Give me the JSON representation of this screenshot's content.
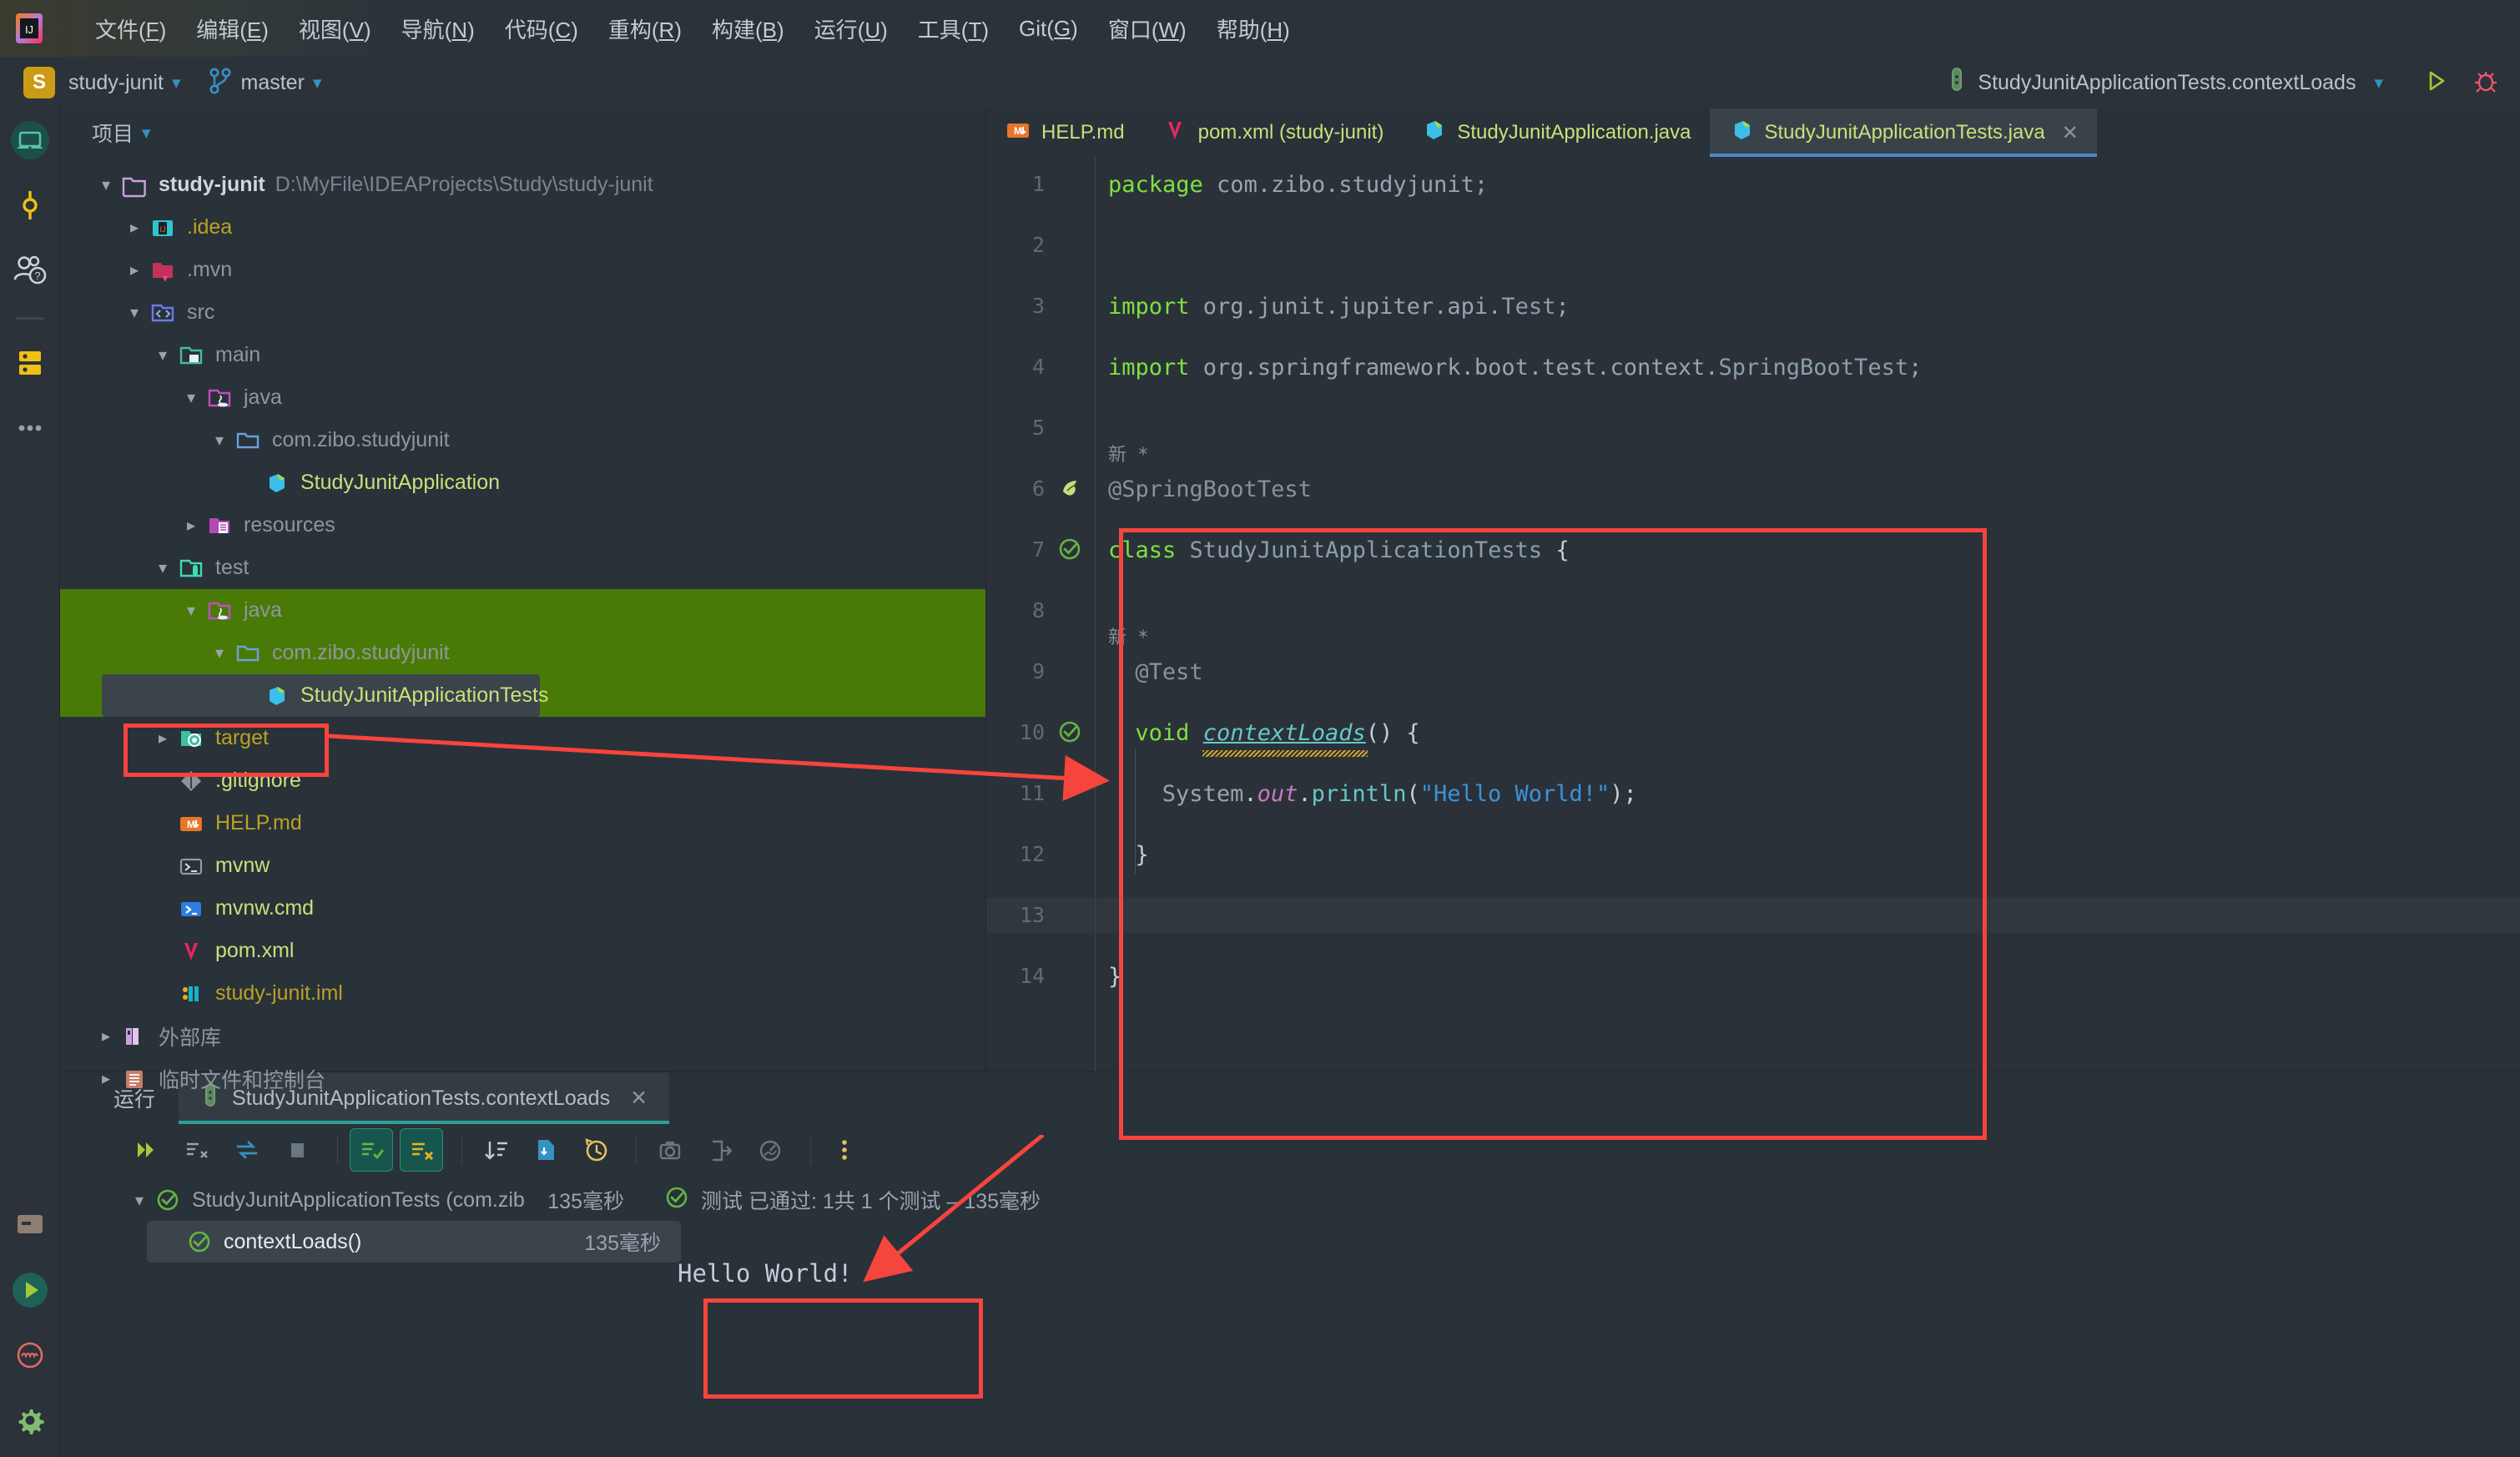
{
  "menubar": {
    "items": [
      {
        "label": "文件(F)",
        "mnemonic": "F"
      },
      {
        "label": "编辑(E)",
        "mnemonic": "E"
      },
      {
        "label": "视图(V)",
        "mnemonic": "V"
      },
      {
        "label": "导航(N)",
        "mnemonic": "N"
      },
      {
        "label": "代码(C)",
        "mnemonic": "C"
      },
      {
        "label": "重构(R)",
        "mnemonic": "R"
      },
      {
        "label": "构建(B)",
        "mnemonic": "B"
      },
      {
        "label": "运行(U)",
        "mnemonic": "U"
      },
      {
        "label": "工具(T)",
        "mnemonic": "T"
      },
      {
        "label": "Git(G)",
        "mnemonic": "G"
      },
      {
        "label": "窗口(W)",
        "mnemonic": "W"
      },
      {
        "label": "帮助(H)",
        "mnemonic": "H"
      }
    ]
  },
  "navbar": {
    "project_badge": "S",
    "project_name": "study-junit",
    "branch_name": "master",
    "run_config": "StudyJunitApplicationTests.contextLoads"
  },
  "toolstrip": {
    "items": [
      {
        "name": "project-tool-window",
        "icon": "laptop-icon",
        "active": true
      },
      {
        "name": "commit-tool-window",
        "icon": "commit-icon",
        "active": false
      },
      {
        "name": "support-tool-window",
        "icon": "people-question-icon",
        "active": false
      },
      {
        "name": "database-tool-window",
        "icon": "database-icon",
        "active": false
      },
      {
        "name": "more-tool-windows",
        "icon": "ellipsis-icon",
        "active": false
      }
    ],
    "bottom_items": [
      {
        "name": "terminal-tool-window",
        "icon": "terminal-icon"
      },
      {
        "name": "run-tool-window",
        "icon": "run-circle-icon"
      },
      {
        "name": "problems-tool-window",
        "icon": "problems-circle-icon"
      },
      {
        "name": "settings",
        "icon": "gear-icon"
      }
    ]
  },
  "project_panel": {
    "title": "项目",
    "tree": [
      {
        "label": "study-junit",
        "path": "D:\\MyFile\\IDEAProjects\\Study\\study-junit",
        "depth": 0,
        "arrow": "down",
        "icon": "folder-root-icon",
        "style": "root"
      },
      {
        "label": ".idea",
        "depth": 1,
        "arrow": "right",
        "icon": "idea-folder-icon",
        "style": "yellow"
      },
      {
        "label": ".mvn",
        "depth": 1,
        "arrow": "right",
        "icon": "mvn-folder-icon",
        "style": "dim"
      },
      {
        "label": "src",
        "depth": 1,
        "arrow": "down",
        "icon": "src-folder-icon",
        "style": "dim"
      },
      {
        "label": "main",
        "depth": 2,
        "arrow": "down",
        "icon": "main-folder-icon",
        "style": "dim"
      },
      {
        "label": "java",
        "depth": 3,
        "arrow": "down",
        "icon": "java-src-folder-icon",
        "style": "dim"
      },
      {
        "label": "com.zibo.studyjunit",
        "depth": 4,
        "arrow": "down",
        "icon": "package-folder-icon",
        "style": "dim"
      },
      {
        "label": "StudyJunitApplication",
        "depth": 5,
        "arrow": "none",
        "icon": "spring-class-icon",
        "style": "green"
      },
      {
        "label": "resources",
        "depth": 3,
        "arrow": "right",
        "icon": "resources-folder-icon",
        "style": "dim"
      },
      {
        "label": "test",
        "depth": 2,
        "arrow": "down",
        "icon": "test-folder-icon",
        "style": "dim"
      },
      {
        "label": "java",
        "depth": 3,
        "arrow": "down",
        "icon": "java-test-folder-icon",
        "style": "dim",
        "highlight": "green"
      },
      {
        "label": "com.zibo.studyjunit",
        "depth": 4,
        "arrow": "down",
        "icon": "package-folder-icon",
        "style": "dim",
        "highlight": "green"
      },
      {
        "label": "StudyJunitApplicationTests",
        "depth": 5,
        "arrow": "none",
        "icon": "spring-class-icon",
        "style": "green",
        "highlight": "green",
        "selected": true
      },
      {
        "label": "target",
        "depth": 2,
        "arrow": "right",
        "icon": "target-folder-icon",
        "style": "yellow"
      },
      {
        "label": ".gitignore",
        "depth": 2,
        "arrow": "none",
        "icon": "git-icon",
        "style": "green"
      },
      {
        "label": "HELP.md",
        "depth": 2,
        "arrow": "none",
        "icon": "markdown-icon",
        "style": "yellow"
      },
      {
        "label": "mvnw",
        "depth": 2,
        "arrow": "none",
        "icon": "shell-script-icon",
        "style": "green"
      },
      {
        "label": "mvnw.cmd",
        "depth": 2,
        "arrow": "none",
        "icon": "cmd-script-icon",
        "style": "green"
      },
      {
        "label": "pom.xml",
        "depth": 2,
        "arrow": "none",
        "icon": "maven-pom-icon",
        "style": "green"
      },
      {
        "label": "study-junit.iml",
        "depth": 2,
        "arrow": "none",
        "icon": "iml-icon",
        "style": "yellow"
      },
      {
        "label": "外部库",
        "depth": 0,
        "arrow": "right",
        "icon": "external-libraries-icon",
        "style": "dim"
      },
      {
        "label": "临时文件和控制台",
        "depth": 0,
        "arrow": "right",
        "icon": "scratches-icon",
        "style": "dim"
      }
    ]
  },
  "editor": {
    "tabs": [
      {
        "label": "HELP.md",
        "icon": "markdown-icon",
        "active": false
      },
      {
        "label": "pom.xml (study-junit)",
        "icon": "maven-pom-icon",
        "active": false
      },
      {
        "label": "StudyJunitApplication.java",
        "icon": "spring-class-icon",
        "active": false
      },
      {
        "label": "StudyJunitApplicationTests.java",
        "icon": "spring-class-icon",
        "active": true,
        "closable": true
      }
    ],
    "lines": [
      {
        "num": "1",
        "segments": [
          {
            "t": "package",
            "c": "kw"
          },
          {
            "t": " com.zibo.studyjunit;",
            "c": "id"
          }
        ]
      },
      {
        "num": "2",
        "segments": []
      },
      {
        "num": "3",
        "segments": [
          {
            "t": "import",
            "c": "kw"
          },
          {
            "t": " org.junit.jupiter.api.",
            "c": "id"
          },
          {
            "t": "Test",
            "c": "cls"
          },
          {
            "t": ";",
            "c": "id"
          }
        ]
      },
      {
        "num": "4",
        "segments": [
          {
            "t": "import",
            "c": "kw"
          },
          {
            "t": " org.springframework.boot.test.context.",
            "c": "id"
          },
          {
            "t": "SpringBootTest",
            "c": "cls"
          },
          {
            "t": ";",
            "c": "id"
          }
        ]
      },
      {
        "num": "5",
        "segments": []
      },
      {
        "num": "6",
        "segments": [
          {
            "t": "@SpringBootTest",
            "c": "anno"
          }
        ],
        "inlay": "新 *",
        "gutter": "spring-bean-icon"
      },
      {
        "num": "7",
        "segments": [
          {
            "t": "class",
            "c": "kw"
          },
          {
            "t": " StudyJunitApplicationTests ",
            "c": "cls"
          },
          {
            "t": "{",
            "c": "punc"
          }
        ],
        "gutter": "run-test-green-icon"
      },
      {
        "num": "8",
        "segments": []
      },
      {
        "num": "9",
        "segments": [
          {
            "t": "@Test",
            "c": "anno"
          }
        ],
        "inlay": "新 *"
      },
      {
        "num": "10",
        "segments": [
          {
            "t": "void",
            "c": "kw"
          },
          {
            "t": " ",
            "c": "id"
          },
          {
            "t": "contextLoads",
            "c": "mdecl"
          },
          {
            "t": "()",
            "c": "punc"
          },
          {
            "t": " ",
            "c": "id"
          },
          {
            "t": "{",
            "c": "punc"
          }
        ],
        "gutter": "run-test-green-icon"
      },
      {
        "num": "11",
        "segments": [
          {
            "t": "System",
            "c": "id"
          },
          {
            "t": ".",
            "c": "punc"
          },
          {
            "t": "out",
            "c": "mfield"
          },
          {
            "t": ".",
            "c": "punc"
          },
          {
            "t": "println",
            "c": "mcall"
          },
          {
            "t": "(",
            "c": "punc"
          },
          {
            "t": "\"Hello World!\"",
            "c": "str"
          },
          {
            "t": ");",
            "c": "punc"
          }
        ]
      },
      {
        "num": "12",
        "segments": [
          {
            "t": "}",
            "c": "punc"
          }
        ]
      },
      {
        "num": "13",
        "segments": [],
        "caret": true
      },
      {
        "num": "14",
        "segments": [
          {
            "t": "}",
            "c": "punc"
          }
        ]
      }
    ]
  },
  "run_panel": {
    "window_label": "运行",
    "tab_label": "StudyJunitApplicationTests.contextLoads",
    "toolbar": [
      {
        "name": "rerun-button",
        "icon": "rerun-icon"
      },
      {
        "name": "rerun-failed-tests-button",
        "icon": "rerun-failed-icon"
      },
      {
        "name": "toggle-auto-test-button",
        "icon": "auto-test-icon"
      },
      {
        "name": "stop-button",
        "icon": "stop-icon"
      },
      {
        "name": "show-passed-tests-toggle",
        "icon": "show-passed-icon",
        "on": true
      },
      {
        "name": "show-ignored-tests-toggle",
        "icon": "show-ignored-icon",
        "on": true
      },
      {
        "name": "sort-by-duration-button",
        "icon": "sort-icon"
      },
      {
        "name": "open-source-button",
        "icon": "open-file-icon"
      },
      {
        "name": "test-history-button",
        "icon": "history-icon"
      },
      {
        "name": "screenshot-button",
        "icon": "camera-icon"
      },
      {
        "name": "export-test-results-button",
        "icon": "export-icon"
      },
      {
        "name": "profiler-button",
        "icon": "profiler-icon"
      },
      {
        "name": "more-options-button",
        "icon": "kebab-menu-icon"
      }
    ],
    "test_tree": [
      {
        "label": "StudyJunitApplicationTests (com.zib",
        "duration": "135毫秒",
        "status": "passed",
        "depth": 0,
        "arrow": "down",
        "selected": false
      },
      {
        "label": "contextLoads()",
        "duration": "135毫秒",
        "status": "passed",
        "depth": 1,
        "arrow": "none",
        "selected": true
      }
    ],
    "status_line": "测试 已通过: 1共 1 个测试 – 135毫秒",
    "console_output": "Hello World!"
  },
  "annotations": {
    "color": "#f6453c",
    "rect_tree_label": "StudyJunitApplicationTests",
    "rect_code_block": "class body region",
    "rect_console": "Hello World!"
  }
}
